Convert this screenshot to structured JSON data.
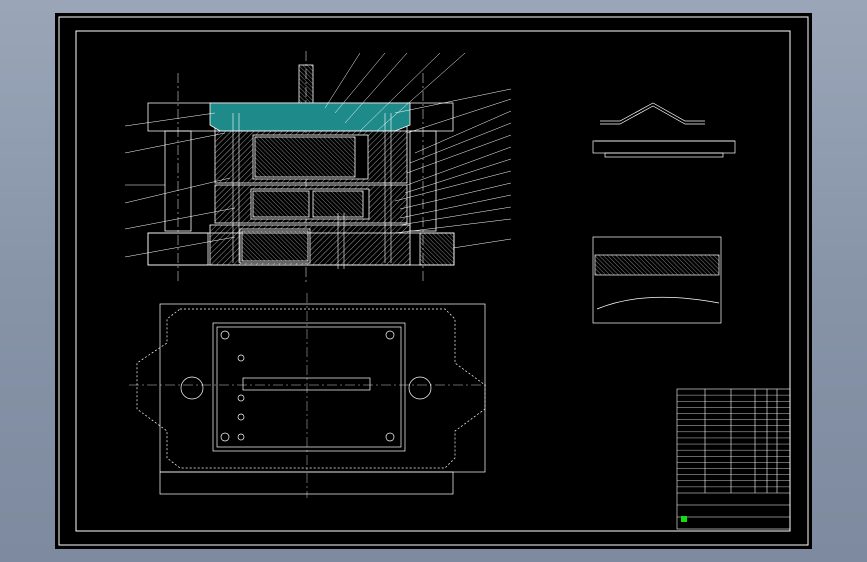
{
  "colors": {
    "background": "#8a96aa",
    "paper": "#000000",
    "line": "#ffffff",
    "section_fill": "#1f8a8a",
    "green_cell": "#10e010"
  },
  "title_block": {
    "rows": 17,
    "cols": 9
  }
}
